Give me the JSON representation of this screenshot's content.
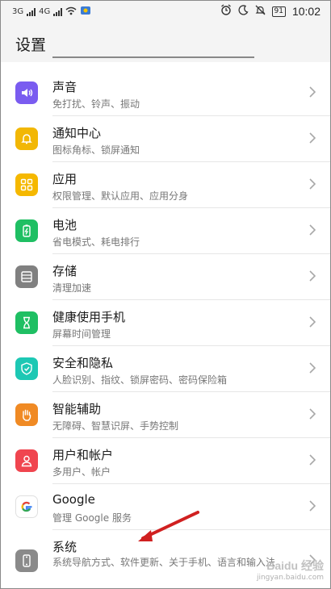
{
  "status": {
    "sig1": "3G",
    "sig2": "4G",
    "battery": "91",
    "time": "10:02"
  },
  "header": {
    "title": "设置"
  },
  "items": [
    {
      "label": "声音",
      "desc": "免打扰、铃声、振动",
      "icon": "volume-icon",
      "color": "#7a5cf0"
    },
    {
      "label": "通知中心",
      "desc": "图标角标、锁屏通知",
      "icon": "bell-icon",
      "color": "#f2b705"
    },
    {
      "label": "应用",
      "desc": "权限管理、默认应用、应用分身",
      "icon": "apps-grid-icon",
      "color": "#f5b800"
    },
    {
      "label": "电池",
      "desc": "省电模式、耗电排行",
      "icon": "battery-icon",
      "color": "#1fbf63"
    },
    {
      "label": "存储",
      "desc": "清理加速",
      "icon": "storage-icon",
      "color": "#808080"
    },
    {
      "label": "健康使用手机",
      "desc": "屏幕时间管理",
      "icon": "hourglass-icon",
      "color": "#1fbf63"
    },
    {
      "label": "安全和隐私",
      "desc": "人脸识别、指纹、锁屏密码、密码保险箱",
      "icon": "shield-icon",
      "color": "#1dc8b4"
    },
    {
      "label": "智能辅助",
      "desc": "无障碍、智慧识屏、手势控制",
      "icon": "hand-icon",
      "color": "#f08a24"
    },
    {
      "label": "用户和帐户",
      "desc": "多用户、帐户",
      "icon": "user-icon",
      "color": "#f0454f"
    },
    {
      "label": "Google",
      "desc": "管理 Google 服务",
      "icon": "google-icon",
      "color": "#ffffff"
    },
    {
      "label": "系统",
      "desc": "系统导航方式、软件更新、关于手机、语言和输入法",
      "icon": "phone-icon",
      "color": "#8a8a8a"
    }
  ],
  "watermark": {
    "brand": "Baidu 经验",
    "url": "jingyan.baidu.com"
  },
  "accent": "#d02020"
}
